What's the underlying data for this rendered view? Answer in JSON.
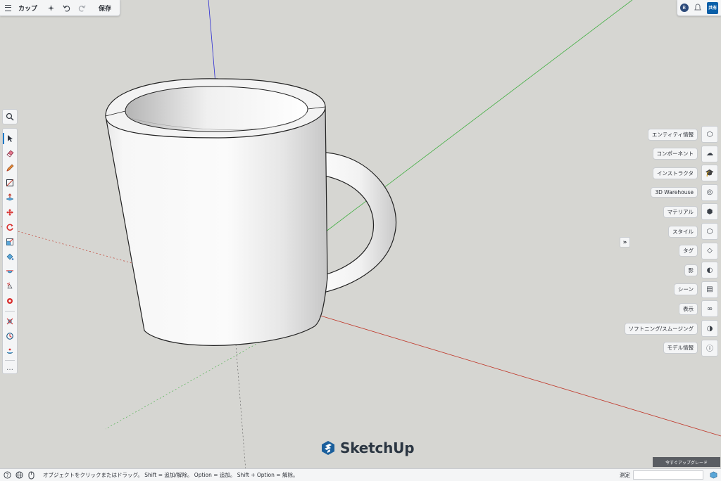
{
  "toolbar": {
    "menu_icon": "hamburger-menu-icon",
    "file_title": "カップ",
    "save_label": "保存"
  },
  "top_right": {
    "avatar_initial": "B",
    "share_label": "共有"
  },
  "left_tools": [
    {
      "name": "select-tool",
      "icon": "arrow-cursor-icon"
    },
    {
      "name": "eraser-tool",
      "icon": "eraser-icon"
    },
    {
      "name": "pencil-tool",
      "icon": "pencil-icon"
    },
    {
      "name": "rectangle-tool",
      "icon": "rectangle-icon"
    },
    {
      "name": "push-pull-tool",
      "icon": "push-pull-icon"
    },
    {
      "name": "move-tool",
      "icon": "move-icon"
    },
    {
      "name": "rotate-tool",
      "icon": "rotate-icon"
    },
    {
      "name": "scale-tool",
      "icon": "scale-icon"
    },
    {
      "name": "paint-bucket-tool",
      "icon": "paint-bucket-icon"
    },
    {
      "name": "follow-me-tool",
      "icon": "follow-me-icon"
    },
    {
      "name": "tape-measure-tool",
      "icon": "tape-measure-icon"
    },
    {
      "name": "section-plane-tool",
      "icon": "section-plane-icon"
    },
    {
      "name": "orbit-tool",
      "icon": "orbit-icon"
    },
    {
      "name": "walk-tool",
      "icon": "walk-icon"
    },
    {
      "name": "look-around-tool",
      "icon": "look-around-icon"
    }
  ],
  "more_tools_label": "…",
  "right_panels": [
    {
      "label": "エンティティ情報",
      "icon": "entity-info-icon"
    },
    {
      "label": "コンポーネント",
      "icon": "components-icon"
    },
    {
      "label": "インストラクタ",
      "icon": "instructor-icon"
    },
    {
      "label": "3D Warehouse",
      "icon": "warehouse-icon"
    },
    {
      "label": "マテリアル",
      "icon": "materials-icon"
    },
    {
      "label": "スタイル",
      "icon": "styles-icon"
    },
    {
      "label": "タグ",
      "icon": "tag-icon"
    },
    {
      "label": "影",
      "icon": "shadow-icon"
    },
    {
      "label": "シーン",
      "icon": "scenes-icon"
    },
    {
      "label": "表示",
      "icon": "display-icon"
    },
    {
      "label": "ソフトニング/スムージング",
      "icon": "soften-icon"
    },
    {
      "label": "モデル情報",
      "icon": "info-icon"
    }
  ],
  "expand_label": "»",
  "logo_text": "SketchUp",
  "upgrade_label": "今すぐアップグレード",
  "status": {
    "message": "オブジェクトをクリックまたはドラッグ。 Shift = 追加/解除。 Option = 追加。 Shift + Option = 解除。",
    "measure_label": "測定",
    "measure_value": ""
  },
  "colors": {
    "canvas": "#d6d6d2",
    "axis_red": "#c0392b",
    "axis_green": "#3fae3f",
    "axis_blue": "#2a2ad4",
    "accent": "#1b7ac7"
  }
}
